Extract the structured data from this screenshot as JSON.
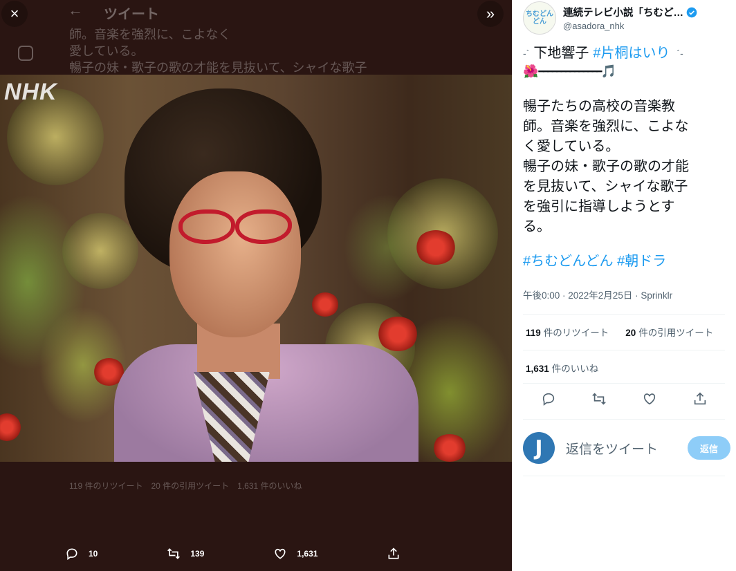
{
  "viewer": {
    "close_icon": "×",
    "expand_icon": "»",
    "background": {
      "page_title": "ツイート",
      "back_arrow": "←",
      "text_lines": [
        "師。音楽を強烈に、こよなく",
        "愛している。",
        "暢子の妹・歌子の歌の才能を見抜いて、シャイな歌子"
      ],
      "stats_ghost": "119 件のリツイート　20 件の引用ツイート　1,631 件のいいね"
    },
    "photo": {
      "watermark": "NHK"
    },
    "actions": {
      "reply_count": "10",
      "retweet_count": "139",
      "like_count": "1,631"
    }
  },
  "tweet": {
    "display_name": "連続テレビ小説「ちむど…",
    "handle": "@asadora_nhk",
    "avatar_text": "ちむどんどん",
    "deco_top_left": "-`",
    "name_text": "下地響子",
    "name_tag": "#片桐はいり",
    "deco_top_right": "´-",
    "deco_bar": "━━━━━━━━━━━━━━",
    "deco_flower": "🌺",
    "deco_note": "🎵",
    "body": "暢子たちの高校の音楽教\n師。音楽を強烈に、こよな\nく愛している。\n暢子の妹・歌子の歌の才能\nを見抜いて、シャイな歌子\nを強引に指導しようとす\nる。",
    "hashtag1": "#ちむどんどん",
    "hashtag2": "#朝ドラ",
    "meta": "午後0:00 · 2022年2月25日 · Sprinklr",
    "retweets_num": "119",
    "retweets_label": "件のリツイート",
    "quotes_num": "20",
    "quotes_label": "件の引用ツイート",
    "likes_num": "1,631",
    "likes_label": "件のいいね"
  },
  "reply": {
    "avatar_letter": "J",
    "placeholder": "返信をツイート",
    "button": "返信"
  },
  "colors": {
    "accent": "#1d9bf0",
    "reply_button": "#8ecdf8",
    "viewer_bg": "#2a1512"
  }
}
